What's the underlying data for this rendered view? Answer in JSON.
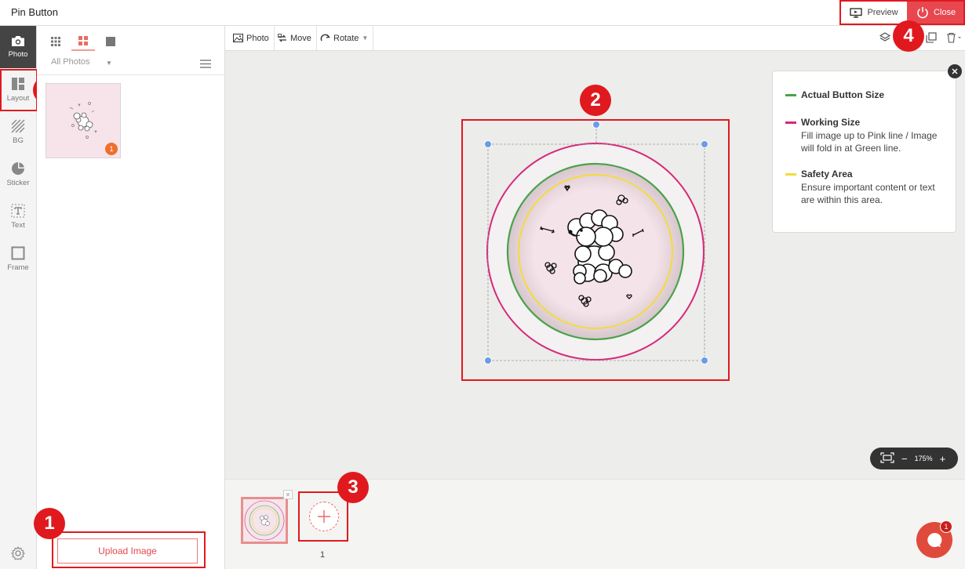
{
  "app": {
    "title": "Pin Button"
  },
  "header": {
    "preview_label": "Preview",
    "close_label": "Close"
  },
  "rail": {
    "items": [
      {
        "label": "Photo",
        "icon": "camera-icon"
      },
      {
        "label": "Layout",
        "icon": "layout-icon"
      },
      {
        "label": "BG",
        "icon": "background-pattern-icon"
      },
      {
        "label": "Sticker",
        "icon": "sticker-icon"
      },
      {
        "label": "Text",
        "icon": "text-icon"
      },
      {
        "label": "Frame",
        "icon": "frame-icon"
      }
    ],
    "settings_icon": "gear-icon"
  },
  "panel": {
    "view_tabs": [
      "grid-small-icon",
      "grid-large-icon",
      "single-view-icon"
    ],
    "album_select": "All Photos",
    "photo_count_badge": "1",
    "upload_label": "Upload Image"
  },
  "toolbar": {
    "photo_label": "Photo",
    "move_label": "Move",
    "rotate_label": "Rotate",
    "right_icons": [
      "layers-icon",
      "duplicate-icon",
      "trash-icon"
    ]
  },
  "legend": {
    "items": [
      {
        "title": "Actual Button Size",
        "desc": "",
        "color": "#4aa24a"
      },
      {
        "title": "Working Size",
        "desc": "Fill image up to Pink line / Image will fold in at Green line.",
        "color": "#d6287a"
      },
      {
        "title": "Safety Area",
        "desc": "Ensure important content or text are within this area.",
        "color": "#f2dc3c"
      }
    ]
  },
  "zoom": {
    "level": "175%",
    "minus": "−",
    "plus": "+"
  },
  "pages": {
    "page_number": "1"
  },
  "chat": {
    "badge": "1"
  },
  "markers": [
    "1",
    "2",
    "3",
    "4"
  ]
}
